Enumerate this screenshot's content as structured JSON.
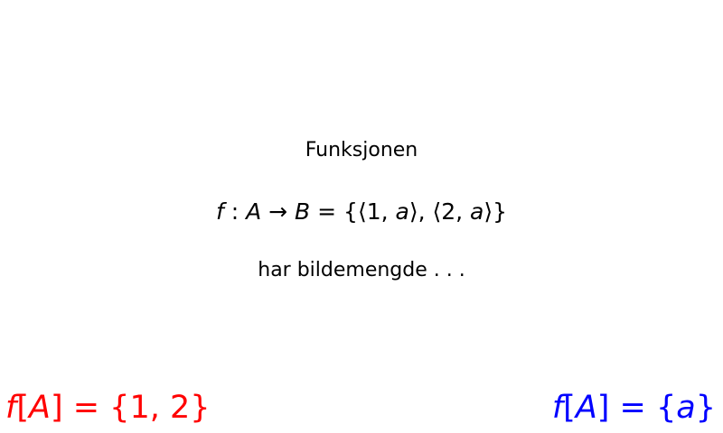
{
  "slide": {
    "intro_text": "Funksjonen",
    "function_definition": {
      "f": "f",
      "colon": " : ",
      "domain": "A",
      "arrow": " → ",
      "codomain": "B",
      "equals": " = ",
      "rest": "{⟨1, ",
      "a1": "a",
      "mid": "⟩, ⟨2, ",
      "a2": "a",
      "end": "⟩}"
    },
    "followup_text": "har bildemengde . . ."
  },
  "answer_options": [
    {
      "f": "f",
      "arg": "[",
      "A": "A",
      "rhs": "] = {1, 2}",
      "color": "#ff0000"
    },
    {
      "f": "f",
      "arg": "[",
      "A": "A",
      "rhs_open": "] = {",
      "a": "a",
      "rhs_close": "}",
      "color": "#0000ff"
    }
  ]
}
